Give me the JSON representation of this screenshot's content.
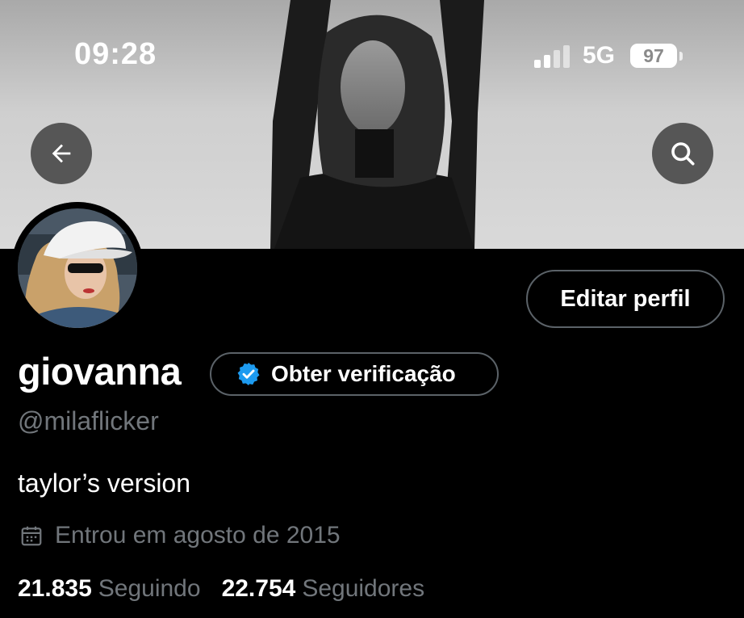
{
  "status_bar": {
    "time": "09:28",
    "network": "5G",
    "battery": "97"
  },
  "header": {
    "back_icon": "arrow-left-icon",
    "search_icon": "search-icon"
  },
  "profile": {
    "edit_button_label": "Editar perfil",
    "display_name": "giovanna",
    "verification_label": "Obter verificação",
    "handle": "@milaflicker",
    "bio": "taylor’s version",
    "joined": "Entrou em agosto de 2015",
    "following_count": "21.835",
    "following_label": "Seguindo",
    "followers_count": "22.754",
    "followers_label": "Seguidores"
  },
  "colors": {
    "background": "#000000",
    "secondary_text": "#71767b",
    "verified_badge": "#1d9bf0"
  }
}
